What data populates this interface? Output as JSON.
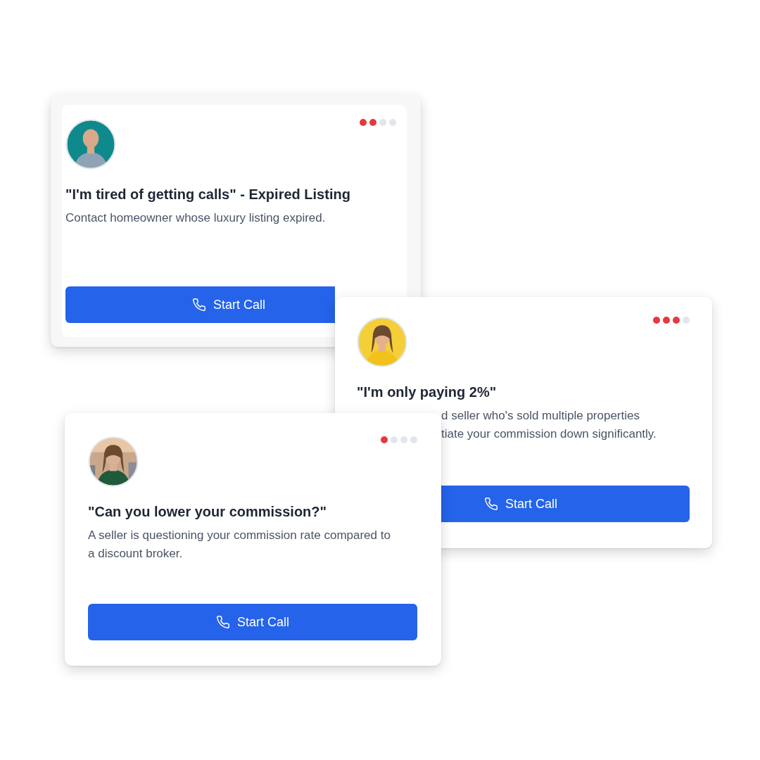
{
  "cards": [
    {
      "avatar": {
        "kind": "picture"
      },
      "stars": 2,
      "title": "\"I'm tired of getting calls\" - Expired Listing",
      "description": [
        "Contact homeowner whose luxury listing expired."
      ],
      "button": "Start Call"
    },
    {
      "avatar": {
        "kind": "picture"
      },
      "stars": 3,
      "title": "\"I'm only paying 2%\"",
      "description_visible": [
        "d seller who's sold multiple properties",
        "tiate your commission down significantly."
      ],
      "button": "Start Call"
    },
    {
      "avatar": {
        "kind": "picture"
      },
      "stars": 1,
      "title": "\"Can you lower your commission?\"",
      "description": [
        "A seller is questioning your commission rate compared to a discount broker."
      ],
      "button": "Start Call"
    }
  ]
}
